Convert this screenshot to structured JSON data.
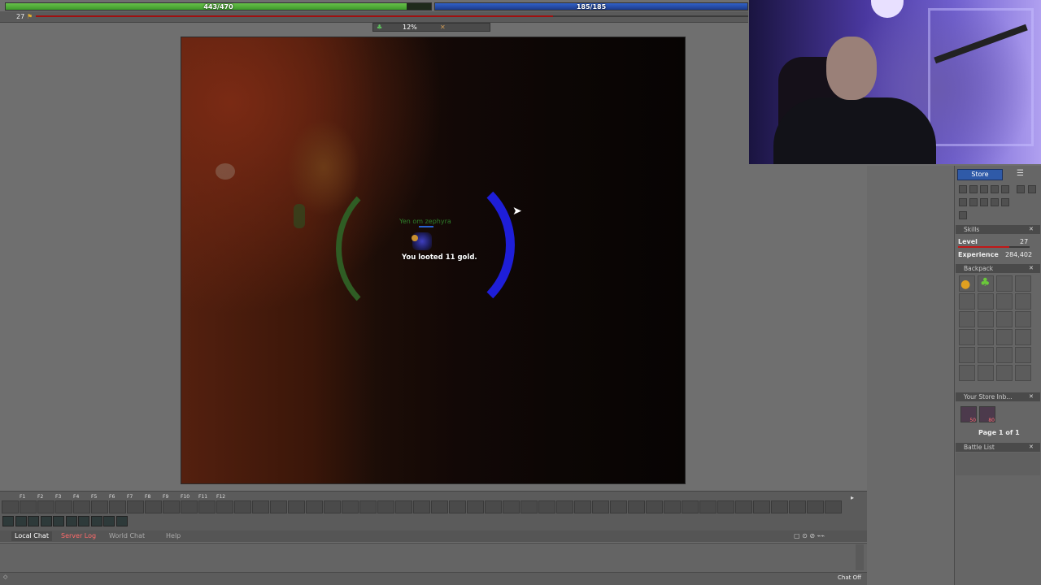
{
  "hud": {
    "health_text": "443/470",
    "health_fraction": 0.943,
    "mana_text": "185/185",
    "mana_fraction": 1.0,
    "level_number": "27",
    "level_icon": "⚑",
    "condition_percent": "12%",
    "condition_icon": "♣",
    "condition_icon2": "✕"
  },
  "game": {
    "player_name": "Yen om zephyra",
    "loot_message": "You looted 11 gold.",
    "cursor": "➤"
  },
  "action_bar": {
    "function_keys": [
      "F1",
      "F2",
      "F3",
      "F4",
      "F5",
      "F6",
      "F7",
      "F8",
      "F9",
      "F10",
      "F11",
      "F12"
    ],
    "scroll_icon": "▸"
  },
  "chat": {
    "tabs": {
      "local": "Local Chat",
      "server": "Server Log",
      "world": "World Chat",
      "help": "Help"
    },
    "controls": "▢ ⊙ ⊘ ⌁⌁",
    "chat_off": "Chat Off",
    "chat_icon": "◇"
  },
  "panel": {
    "store_label": "Store",
    "menu_icon": "☰",
    "skills": {
      "title": "Skills",
      "level_label": "Level",
      "level_value": "27",
      "level_progress": 0.72,
      "experience_label": "Experience",
      "experience_value": "284,402"
    },
    "backpack_title": "Backpack",
    "store_inbox_title": "Your Store Inb...",
    "store_inbox_counts": [
      "50",
      "80"
    ],
    "page_info": "Page 1 of 1",
    "battle_list_title": "Battle List",
    "close_icon": "✕"
  },
  "colors": {
    "health": "#4caf2f",
    "mana": "#2452b8",
    "server_log": "#ff6a6a",
    "store": "#2f5aa8"
  }
}
